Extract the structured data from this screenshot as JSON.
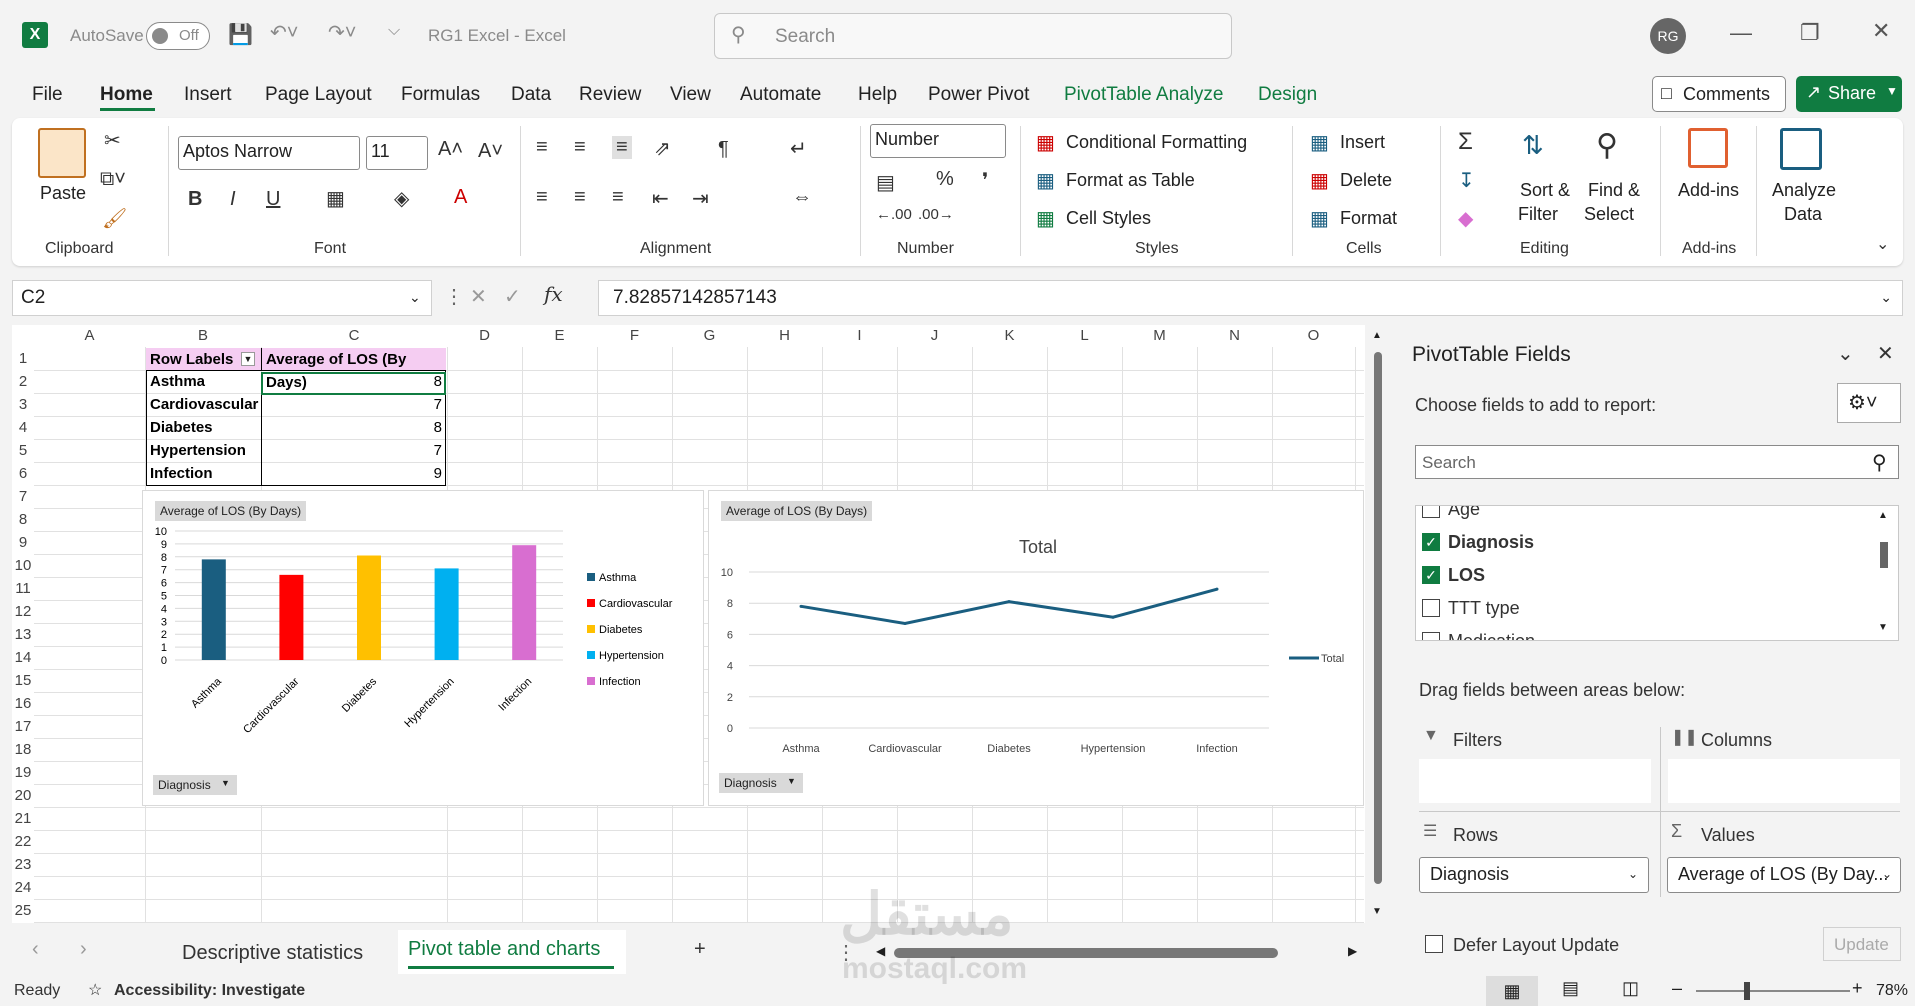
{
  "titlebar": {
    "autosave_label": "AutoSave",
    "autosave_state": "Off",
    "doc_title": "RG1 Excel  -  Excel",
    "search_placeholder": "Search",
    "user_initials": "RG"
  },
  "menu": {
    "tabs": [
      "File",
      "Home",
      "Insert",
      "Page Layout",
      "Formulas",
      "Data",
      "Review",
      "View",
      "Automate",
      "Help",
      "Power Pivot",
      "PivotTable Analyze",
      "Design"
    ],
    "comments": "Comments",
    "share": "Share"
  },
  "ribbon": {
    "paste": "Paste",
    "font_name": "Aptos Narrow",
    "font_size": "11",
    "number_format": "Number",
    "conditional_formatting": "Conditional Formatting",
    "format_as_table": "Format as Table",
    "cell_styles": "Cell Styles",
    "insert": "Insert",
    "delete": "Delete",
    "format": "Format",
    "sort_filter_1": "Sort &",
    "sort_filter_2": "Filter",
    "find_select_1": "Find &",
    "find_select_2": "Select",
    "addins": "Add-ins",
    "analyze_1": "Analyze",
    "analyze_2": "Data",
    "groups": {
      "clipboard": "Clipboard",
      "font": "Font",
      "alignment": "Alignment",
      "number": "Number",
      "styles": "Styles",
      "cells": "Cells",
      "editing": "Editing",
      "addins": "Add-ins"
    }
  },
  "formula_bar": {
    "name_box": "C2",
    "fx": "fx",
    "value": "7.82857142857143"
  },
  "sheet": {
    "columns": [
      "A",
      "B",
      "C",
      "D",
      "E",
      "F",
      "G",
      "H",
      "I",
      "J",
      "K",
      "L",
      "M",
      "N",
      "O"
    ],
    "rows": [
      "1",
      "2",
      "3",
      "4",
      "5",
      "6",
      "7",
      "8",
      "9",
      "10",
      "11",
      "12",
      "13",
      "14",
      "15",
      "16",
      "17",
      "18",
      "19",
      "20",
      "21",
      "22",
      "23",
      "24",
      "25"
    ],
    "pivot": {
      "header_label": "Row Labels",
      "header_value": "Average of LOS (By Days)",
      "rows": [
        {
          "label": "Asthma",
          "value": "8"
        },
        {
          "label": "Cardiovascular",
          "value": "7"
        },
        {
          "label": "Diabetes",
          "value": "8"
        },
        {
          "label": "Hypertension",
          "value": "7"
        },
        {
          "label": "Infection",
          "value": "9"
        }
      ]
    }
  },
  "chart_data": [
    {
      "type": "bar",
      "field_button": "Average of LOS (By Days)",
      "axis_button": "Diagnosis",
      "categories": [
        "Asthma",
        "Cardiovascular",
        "Diabetes",
        "Hypertension",
        "Infection"
      ],
      "series": [
        {
          "values": [
            7.8,
            6.6,
            8.1,
            7.1,
            8.9
          ]
        }
      ],
      "colors": [
        "#1a5e80",
        "#ff0000",
        "#ffc000",
        "#00b0f0",
        "#d86ed0"
      ],
      "ylim": [
        0,
        10
      ],
      "yticks": [
        "0",
        "1",
        "2",
        "3",
        "4",
        "5",
        "6",
        "7",
        "8",
        "9",
        "10"
      ],
      "legend": [
        "Asthma",
        "Cardiovascular",
        "Diabetes",
        "Hypertension",
        "Infection"
      ],
      "legend_position": "right",
      "grid": true
    },
    {
      "type": "line",
      "field_button": "Average of LOS (By Days)",
      "axis_button": "Diagnosis",
      "title": "Total",
      "categories": [
        "Asthma",
        "Cardiovascular",
        "Diabetes",
        "Hypertension",
        "Infection"
      ],
      "series": [
        {
          "name": "Total",
          "values": [
            7.8,
            6.7,
            8.1,
            7.1,
            8.9
          ]
        }
      ],
      "color": "#1a5e80",
      "ylim": [
        0,
        10
      ],
      "yticks": [
        "0",
        "2",
        "4",
        "6",
        "8",
        "10"
      ],
      "legend_position": "right",
      "grid": true
    }
  ],
  "sheet_tabs": {
    "tabs": [
      "Descriptive statistics",
      "Pivot table and charts"
    ],
    "active": "Pivot table and charts"
  },
  "pivot_pane": {
    "title": "PivotTable Fields",
    "choose_label": "Choose fields to add to report:",
    "search_placeholder": "Search",
    "fields": [
      {
        "name": "Age",
        "checked": false
      },
      {
        "name": "Diagnosis",
        "checked": true
      },
      {
        "name": "LOS",
        "checked": true
      },
      {
        "name": "TTT type",
        "checked": false
      },
      {
        "name": "Medication",
        "checked": false
      }
    ],
    "drag_label": "Drag fields between areas below:",
    "filters": "Filters",
    "columns": "Columns",
    "rows": "Rows",
    "values": "Values",
    "rows_value": "Diagnosis",
    "values_value": "Average of LOS (By Day...",
    "defer": "Defer Layout Update",
    "update": "Update"
  },
  "status": {
    "ready": "Ready",
    "accessibility": "Accessibility: Investigate",
    "zoom": "78%"
  },
  "watermark": {
    "arabic": "مستقل",
    "latin": "mostaql.com"
  }
}
